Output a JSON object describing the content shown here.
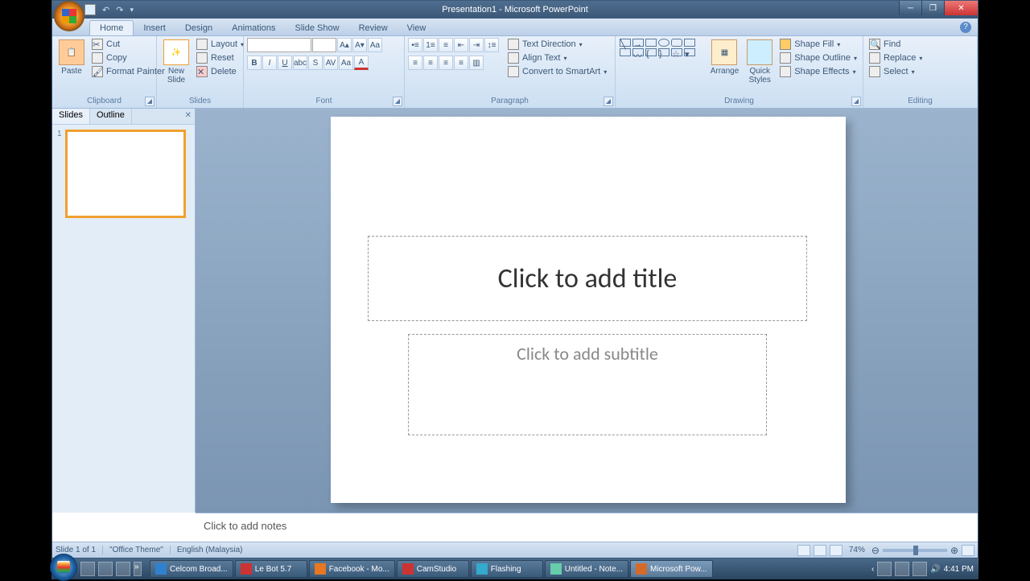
{
  "titlebar": {
    "doc": "Presentation1",
    "app": "Microsoft PowerPoint"
  },
  "tabs": [
    "Home",
    "Insert",
    "Design",
    "Animations",
    "Slide Show",
    "Review",
    "View"
  ],
  "ribbon": {
    "clipboard": {
      "label": "Clipboard",
      "paste": "Paste",
      "cut": "Cut",
      "copy": "Copy",
      "fmt": "Format Painter"
    },
    "slides": {
      "label": "Slides",
      "new": "New\nSlide",
      "layout": "Layout",
      "reset": "Reset",
      "delete": "Delete"
    },
    "font": {
      "label": "Font"
    },
    "para": {
      "label": "Paragraph",
      "textdir": "Text Direction",
      "align": "Align Text",
      "convert": "Convert to SmartArt"
    },
    "drawing": {
      "label": "Drawing",
      "arrange": "Arrange",
      "quick": "Quick\nStyles",
      "fill": "Shape Fill",
      "outline": "Shape Outline",
      "effects": "Shape Effects"
    },
    "editing": {
      "label": "Editing",
      "find": "Find",
      "replace": "Replace",
      "select": "Select"
    }
  },
  "panel": {
    "tab1": "Slides",
    "tab2": "Outline",
    "num": "1"
  },
  "slide": {
    "title": "Click to add title",
    "sub": "Click to add subtitle"
  },
  "notes": "Click to add notes",
  "status": {
    "slide": "Slide 1 of 1",
    "theme": "\"Office Theme\"",
    "lang": "English (Malaysia)",
    "zoom": "74%"
  },
  "taskbar": {
    "items": [
      {
        "label": "Celcom Broad...",
        "color": "#3080d0"
      },
      {
        "label": "Le Bot 5.7",
        "color": "#cc3333"
      },
      {
        "label": "Facebook - Mo...",
        "color": "#e77722"
      },
      {
        "label": "CamStudio",
        "color": "#cc3333"
      },
      {
        "label": "Flashing",
        "color": "#33aacc"
      },
      {
        "label": "Untitled - Note...",
        "color": "#66ccaa"
      },
      {
        "label": "Microsoft Pow...",
        "color": "#d46a2a"
      }
    ],
    "time": "4:41 PM"
  }
}
